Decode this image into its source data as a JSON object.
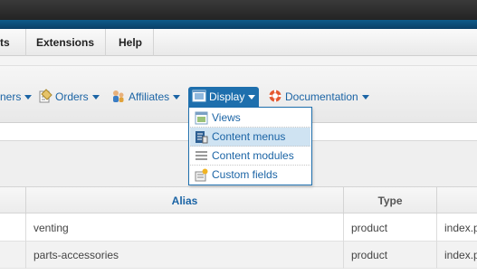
{
  "menubar": {
    "items": [
      {
        "label": "ts"
      },
      {
        "label": "Extensions"
      },
      {
        "label": "Help"
      }
    ]
  },
  "submenu": {
    "items": [
      {
        "label": "ners",
        "icon": "users-icon"
      },
      {
        "label": "Orders",
        "icon": "orders-icon"
      },
      {
        "label": "Affiliates",
        "icon": "affiliates-icon"
      },
      {
        "label": "Display",
        "icon": "display-icon"
      },
      {
        "label": "Documentation",
        "icon": "lifebuoy-icon"
      }
    ]
  },
  "dropdown": {
    "items": [
      {
        "label": "Views",
        "icon": "views-icon"
      },
      {
        "label": "Content menus",
        "icon": "content-menus-icon"
      },
      {
        "label": "Content modules",
        "icon": "content-modules-icon"
      },
      {
        "label": "Custom fields",
        "icon": "custom-fields-icon"
      }
    ]
  },
  "table": {
    "headers": [
      "Alias",
      "Type"
    ],
    "rows": [
      {
        "alias": "venting",
        "type": "product",
        "link": "index.p"
      },
      {
        "alias": "parts-accessories",
        "type": "product",
        "link": "index.p"
      }
    ]
  },
  "colors": {
    "accent": "#1e6fad",
    "link": "#1b64a5",
    "highlight": "#cfe3f2"
  }
}
